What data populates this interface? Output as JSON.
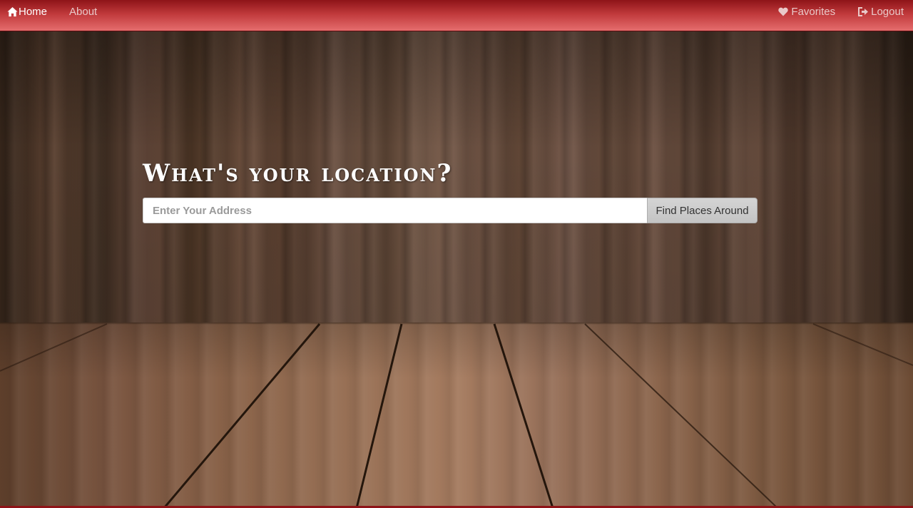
{
  "navbar": {
    "home": {
      "label": "Home",
      "icon": "home-icon"
    },
    "about": {
      "label": "About"
    },
    "favorites": {
      "label": "Favorites",
      "icon": "heart-icon"
    },
    "logout": {
      "label": "Logout",
      "icon": "logout-icon"
    }
  },
  "hero": {
    "title": "What's your location?",
    "search": {
      "placeholder": "Enter Your Address",
      "value": "",
      "button_label": "Find Places Around"
    }
  },
  "colors": {
    "navbar_top": "#8e1418",
    "navbar_bottom": "#e56d6d",
    "nav_text": "#e9c9c9",
    "nav_active_text": "#ffffff",
    "button_bg": "#c9c9c9"
  }
}
